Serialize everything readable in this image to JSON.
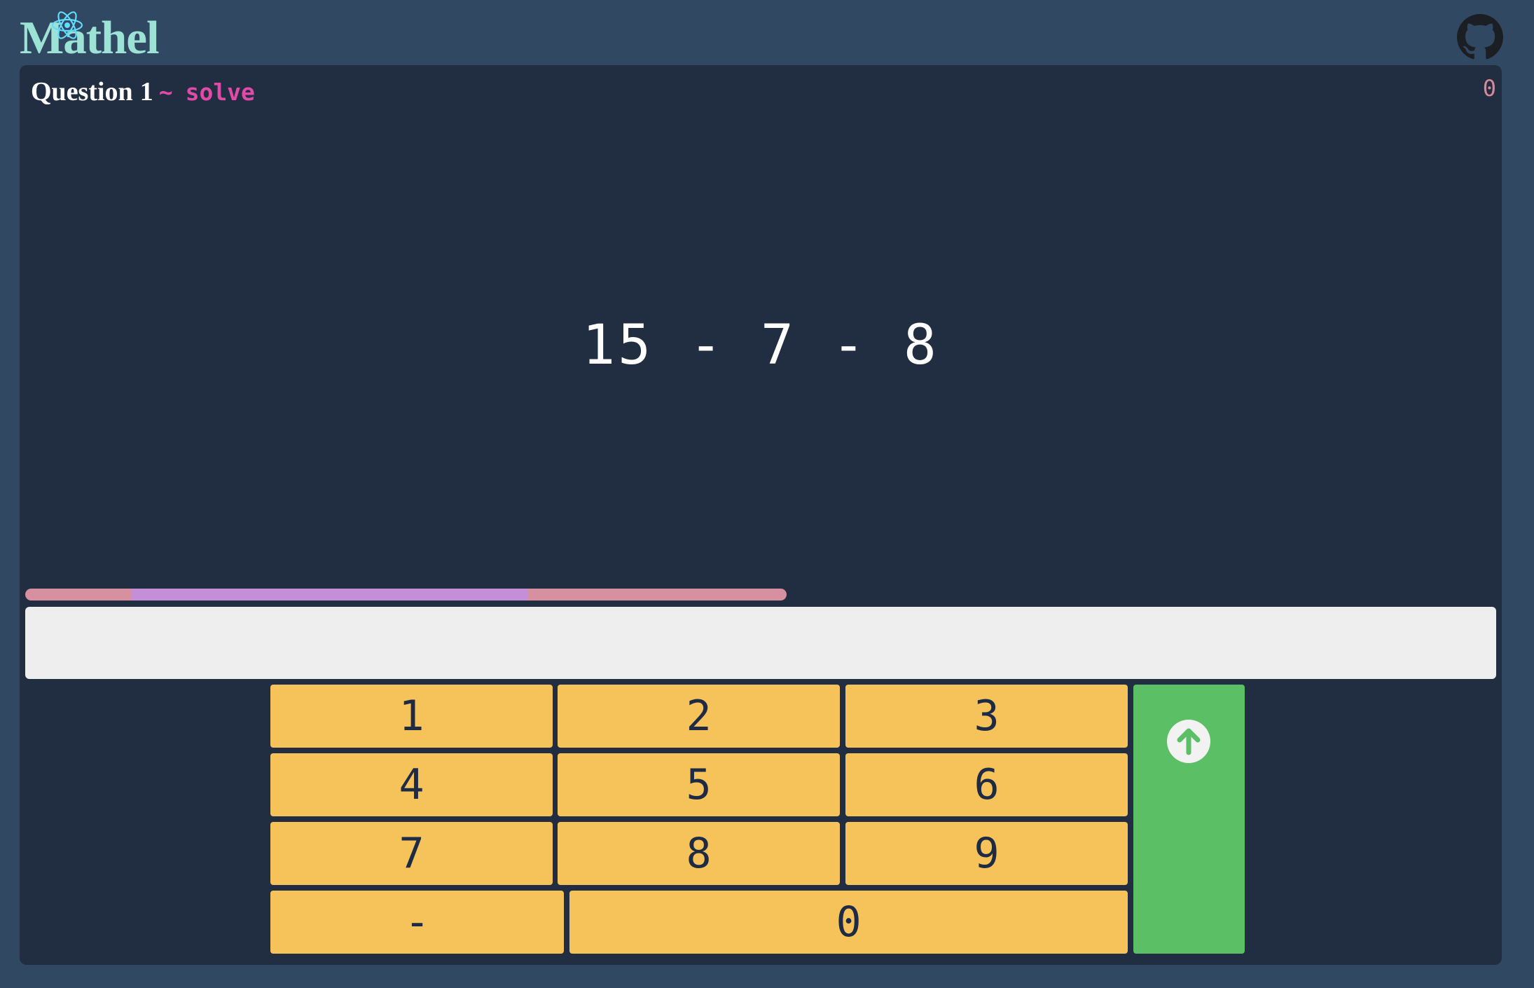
{
  "app": {
    "logo_text": "Mathel",
    "logo_icon": "atom-icon",
    "github_icon": "github-icon"
  },
  "question": {
    "label": "Question",
    "number": "1",
    "separator": "~",
    "mode": "solve"
  },
  "score": "0",
  "problem": "15 - 7 - 8",
  "timer": {
    "progress": 0.52
  },
  "answer": {
    "value": "",
    "placeholder": ""
  },
  "keypad": {
    "keys": [
      "1",
      "2",
      "3",
      "4",
      "5",
      "6",
      "7",
      "8",
      "9",
      "-",
      "0"
    ],
    "submit_icon": "arrow-up-circle-icon"
  },
  "colors": {
    "background": "#314862",
    "card": "#212d40",
    "logo": "#9ce3d6",
    "accent": "#e04ba8",
    "key": "#f6c25a",
    "key_text": "#1d2b44",
    "submit": "#5bbf66",
    "progress_a": "#d6909f",
    "progress_b": "#c48fd6"
  }
}
